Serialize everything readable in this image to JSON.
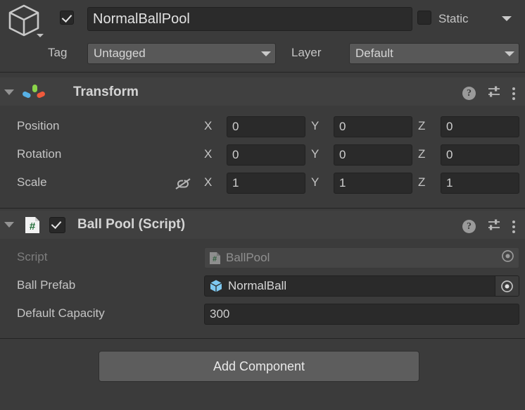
{
  "gameobject": {
    "icon": "gameobject-cube-icon",
    "enabled": true,
    "name": "NormalBallPool",
    "static_label": "Static",
    "static_checked": false,
    "tag_label": "Tag",
    "tag_value": "Untagged",
    "layer_label": "Layer",
    "layer_value": "Default"
  },
  "transform": {
    "title": "Transform",
    "expanded": true,
    "rows": [
      {
        "label": "Position",
        "x": "0",
        "y": "0",
        "z": "0"
      },
      {
        "label": "Rotation",
        "x": "0",
        "y": "0",
        "z": "0"
      },
      {
        "label": "Scale",
        "x": "1",
        "y": "1",
        "z": "1"
      }
    ],
    "axis_labels": {
      "x": "X",
      "y": "Y",
      "z": "Z"
    },
    "constrain_proportions": "off"
  },
  "ballpool": {
    "title": "Ball Pool (Script)",
    "enabled": true,
    "expanded": true,
    "fields": {
      "script_label": "Script",
      "script_value": "BallPool",
      "prefab_label": "Ball Prefab",
      "prefab_value": "NormalBall",
      "capacity_label": "Default Capacity",
      "capacity_value": "300"
    }
  },
  "add_component_label": "Add Component",
  "colors": {
    "panel_bg": "#3b3b3b",
    "header_bg": "#404040",
    "field_bg": "#2a2a2a",
    "popup_bg": "#585858",
    "button_bg": "#5d5d5d",
    "text": "#c4c4c4",
    "text_dim": "#7d7d7d",
    "axis_x": "#f05a3c",
    "axis_y": "#8bd44a",
    "axis_z": "#57b0e5",
    "prefab_blue": "#7ec8f0",
    "script_green": "#1f6b35"
  }
}
